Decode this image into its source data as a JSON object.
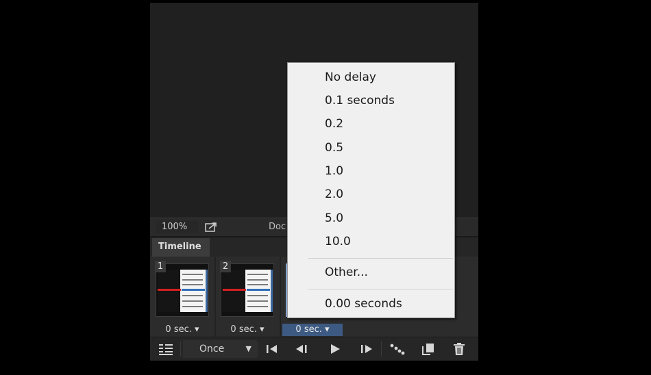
{
  "statusbar": {
    "zoom": "100%",
    "doc_info": "Doc"
  },
  "timeline": {
    "tab_label": "Timeline"
  },
  "frames": [
    {
      "number": "1",
      "delay": "0 sec."
    },
    {
      "number": "2",
      "delay": "0 sec."
    },
    {
      "number": "",
      "delay": "0 sec."
    }
  ],
  "toolbar": {
    "loop_option": "Once"
  },
  "delay_menu": {
    "items": [
      "No delay",
      "0.1 seconds",
      "0.2",
      "0.5",
      "1.0",
      "2.0",
      "5.0",
      "10.0"
    ],
    "other": "Other...",
    "current": "0.00 seconds"
  },
  "colors": {
    "selection": "#3d5a82",
    "menu_bg": "#f0f0f0",
    "panel_bg": "#2c2c2c"
  }
}
